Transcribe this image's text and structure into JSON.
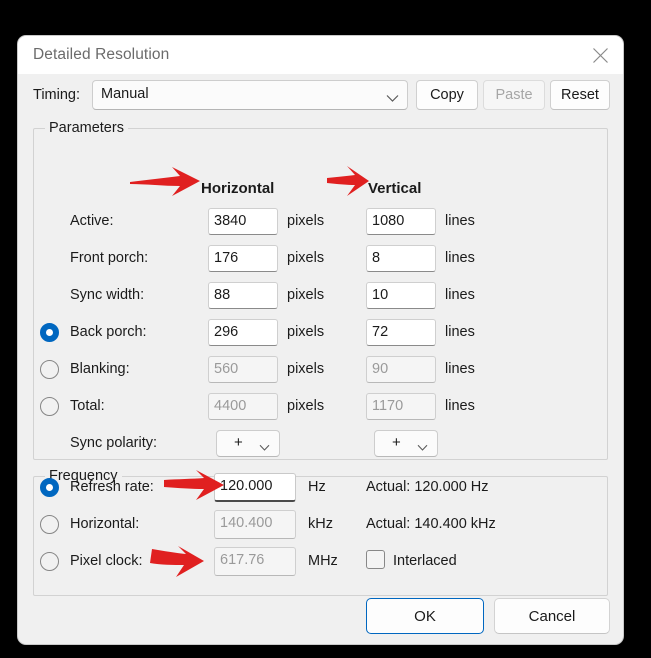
{
  "window": {
    "title": "Detailed Resolution",
    "close_icon": "close-icon"
  },
  "toolbar": {
    "timing_label": "Timing:",
    "timing_value": "Manual",
    "timing_options": [
      "Manual"
    ],
    "copy_label": "Copy",
    "paste_label": "Paste",
    "reset_label": "Reset",
    "paste_disabled": true
  },
  "parameters": {
    "legend": "Parameters",
    "col_horizontal": "Horizontal",
    "col_vertical": "Vertical",
    "unit_pixels": "pixels",
    "unit_lines": "lines",
    "rows": [
      {
        "label": "Active:",
        "h": "3840",
        "v": "1080",
        "h_unit": "pixels",
        "v_unit": "lines",
        "dim": false,
        "radio": null
      },
      {
        "label": "Front porch:",
        "h": "176",
        "v": "8",
        "h_unit": "pixels",
        "v_unit": "lines",
        "dim": false,
        "radio": null
      },
      {
        "label": "Sync width:",
        "h": "88",
        "v": "10",
        "h_unit": "pixels",
        "v_unit": "lines",
        "dim": false,
        "radio": null
      },
      {
        "label": "Back porch:",
        "h": "296",
        "v": "72",
        "h_unit": "pixels",
        "v_unit": "lines",
        "dim": false,
        "radio": "on"
      },
      {
        "label": "Blanking:",
        "h": "560",
        "v": "90",
        "h_unit": "pixels",
        "v_unit": "lines",
        "dim": true,
        "radio": "off"
      },
      {
        "label": "Total:",
        "h": "4400",
        "v": "1170",
        "h_unit": "pixels",
        "v_unit": "lines",
        "dim": true,
        "radio": "off"
      }
    ],
    "sync_polarity": {
      "label": "Sync polarity:",
      "horizontal_value": "+",
      "vertical_value": "+"
    }
  },
  "frequency": {
    "legend": "Frequency",
    "rows": [
      {
        "label": "Refresh rate:",
        "value": "120.000",
        "unit": "Hz",
        "actual": "Actual: 120.000 Hz",
        "dim": false,
        "radio": "on"
      },
      {
        "label": "Horizontal:",
        "value": "140.400",
        "unit": "kHz",
        "actual": "Actual: 140.400 kHz",
        "dim": true,
        "radio": "off"
      },
      {
        "label": "Pixel clock:",
        "value": "617.76",
        "unit": "MHz",
        "actual": "",
        "dim": true,
        "radio": "off"
      }
    ],
    "interlaced_label": "Interlaced",
    "interlaced_checked": false
  },
  "footer": {
    "ok_label": "OK",
    "cancel_label": "Cancel"
  },
  "annotations": {
    "color": "#E02020",
    "arrows": [
      {
        "name": "arrow-active-horizontal"
      },
      {
        "name": "arrow-active-vertical"
      },
      {
        "name": "arrow-refresh-rate"
      },
      {
        "name": "arrow-pixel-clock"
      }
    ]
  },
  "colors": {
    "accent": "#0067C0",
    "dialog_bg": "#F0F0F0",
    "titlebar_bg": "#FFFFFF",
    "annotation_red": "#E02020"
  }
}
